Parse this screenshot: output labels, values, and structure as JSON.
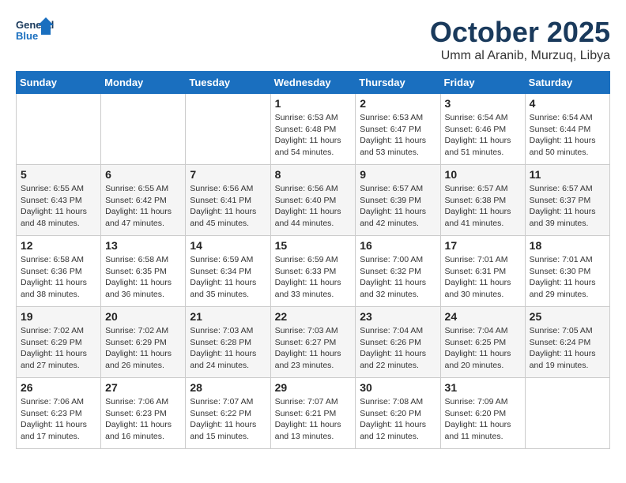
{
  "header": {
    "logo_line1": "General",
    "logo_line2": "Blue",
    "month": "October 2025",
    "location": "Umm al Aranib, Murzuq, Libya"
  },
  "weekdays": [
    "Sunday",
    "Monday",
    "Tuesday",
    "Wednesday",
    "Thursday",
    "Friday",
    "Saturday"
  ],
  "weeks": [
    [
      {
        "day": "",
        "sunrise": "",
        "sunset": "",
        "daylight": ""
      },
      {
        "day": "",
        "sunrise": "",
        "sunset": "",
        "daylight": ""
      },
      {
        "day": "",
        "sunrise": "",
        "sunset": "",
        "daylight": ""
      },
      {
        "day": "1",
        "sunrise": "Sunrise: 6:53 AM",
        "sunset": "Sunset: 6:48 PM",
        "daylight": "Daylight: 11 hours and 54 minutes."
      },
      {
        "day": "2",
        "sunrise": "Sunrise: 6:53 AM",
        "sunset": "Sunset: 6:47 PM",
        "daylight": "Daylight: 11 hours and 53 minutes."
      },
      {
        "day": "3",
        "sunrise": "Sunrise: 6:54 AM",
        "sunset": "Sunset: 6:46 PM",
        "daylight": "Daylight: 11 hours and 51 minutes."
      },
      {
        "day": "4",
        "sunrise": "Sunrise: 6:54 AM",
        "sunset": "Sunset: 6:44 PM",
        "daylight": "Daylight: 11 hours and 50 minutes."
      }
    ],
    [
      {
        "day": "5",
        "sunrise": "Sunrise: 6:55 AM",
        "sunset": "Sunset: 6:43 PM",
        "daylight": "Daylight: 11 hours and 48 minutes."
      },
      {
        "day": "6",
        "sunrise": "Sunrise: 6:55 AM",
        "sunset": "Sunset: 6:42 PM",
        "daylight": "Daylight: 11 hours and 47 minutes."
      },
      {
        "day": "7",
        "sunrise": "Sunrise: 6:56 AM",
        "sunset": "Sunset: 6:41 PM",
        "daylight": "Daylight: 11 hours and 45 minutes."
      },
      {
        "day": "8",
        "sunrise": "Sunrise: 6:56 AM",
        "sunset": "Sunset: 6:40 PM",
        "daylight": "Daylight: 11 hours and 44 minutes."
      },
      {
        "day": "9",
        "sunrise": "Sunrise: 6:57 AM",
        "sunset": "Sunset: 6:39 PM",
        "daylight": "Daylight: 11 hours and 42 minutes."
      },
      {
        "day": "10",
        "sunrise": "Sunrise: 6:57 AM",
        "sunset": "Sunset: 6:38 PM",
        "daylight": "Daylight: 11 hours and 41 minutes."
      },
      {
        "day": "11",
        "sunrise": "Sunrise: 6:57 AM",
        "sunset": "Sunset: 6:37 PM",
        "daylight": "Daylight: 11 hours and 39 minutes."
      }
    ],
    [
      {
        "day": "12",
        "sunrise": "Sunrise: 6:58 AM",
        "sunset": "Sunset: 6:36 PM",
        "daylight": "Daylight: 11 hours and 38 minutes."
      },
      {
        "day": "13",
        "sunrise": "Sunrise: 6:58 AM",
        "sunset": "Sunset: 6:35 PM",
        "daylight": "Daylight: 11 hours and 36 minutes."
      },
      {
        "day": "14",
        "sunrise": "Sunrise: 6:59 AM",
        "sunset": "Sunset: 6:34 PM",
        "daylight": "Daylight: 11 hours and 35 minutes."
      },
      {
        "day": "15",
        "sunrise": "Sunrise: 6:59 AM",
        "sunset": "Sunset: 6:33 PM",
        "daylight": "Daylight: 11 hours and 33 minutes."
      },
      {
        "day": "16",
        "sunrise": "Sunrise: 7:00 AM",
        "sunset": "Sunset: 6:32 PM",
        "daylight": "Daylight: 11 hours and 32 minutes."
      },
      {
        "day": "17",
        "sunrise": "Sunrise: 7:01 AM",
        "sunset": "Sunset: 6:31 PM",
        "daylight": "Daylight: 11 hours and 30 minutes."
      },
      {
        "day": "18",
        "sunrise": "Sunrise: 7:01 AM",
        "sunset": "Sunset: 6:30 PM",
        "daylight": "Daylight: 11 hours and 29 minutes."
      }
    ],
    [
      {
        "day": "19",
        "sunrise": "Sunrise: 7:02 AM",
        "sunset": "Sunset: 6:29 PM",
        "daylight": "Daylight: 11 hours and 27 minutes."
      },
      {
        "day": "20",
        "sunrise": "Sunrise: 7:02 AM",
        "sunset": "Sunset: 6:29 PM",
        "daylight": "Daylight: 11 hours and 26 minutes."
      },
      {
        "day": "21",
        "sunrise": "Sunrise: 7:03 AM",
        "sunset": "Sunset: 6:28 PM",
        "daylight": "Daylight: 11 hours and 24 minutes."
      },
      {
        "day": "22",
        "sunrise": "Sunrise: 7:03 AM",
        "sunset": "Sunset: 6:27 PM",
        "daylight": "Daylight: 11 hours and 23 minutes."
      },
      {
        "day": "23",
        "sunrise": "Sunrise: 7:04 AM",
        "sunset": "Sunset: 6:26 PM",
        "daylight": "Daylight: 11 hours and 22 minutes."
      },
      {
        "day": "24",
        "sunrise": "Sunrise: 7:04 AM",
        "sunset": "Sunset: 6:25 PM",
        "daylight": "Daylight: 11 hours and 20 minutes."
      },
      {
        "day": "25",
        "sunrise": "Sunrise: 7:05 AM",
        "sunset": "Sunset: 6:24 PM",
        "daylight": "Daylight: 11 hours and 19 minutes."
      }
    ],
    [
      {
        "day": "26",
        "sunrise": "Sunrise: 7:06 AM",
        "sunset": "Sunset: 6:23 PM",
        "daylight": "Daylight: 11 hours and 17 minutes."
      },
      {
        "day": "27",
        "sunrise": "Sunrise: 7:06 AM",
        "sunset": "Sunset: 6:23 PM",
        "daylight": "Daylight: 11 hours and 16 minutes."
      },
      {
        "day": "28",
        "sunrise": "Sunrise: 7:07 AM",
        "sunset": "Sunset: 6:22 PM",
        "daylight": "Daylight: 11 hours and 15 minutes."
      },
      {
        "day": "29",
        "sunrise": "Sunrise: 7:07 AM",
        "sunset": "Sunset: 6:21 PM",
        "daylight": "Daylight: 11 hours and 13 minutes."
      },
      {
        "day": "30",
        "sunrise": "Sunrise: 7:08 AM",
        "sunset": "Sunset: 6:20 PM",
        "daylight": "Daylight: 11 hours and 12 minutes."
      },
      {
        "day": "31",
        "sunrise": "Sunrise: 7:09 AM",
        "sunset": "Sunset: 6:20 PM",
        "daylight": "Daylight: 11 hours and 11 minutes."
      },
      {
        "day": "",
        "sunrise": "",
        "sunset": "",
        "daylight": ""
      }
    ]
  ]
}
